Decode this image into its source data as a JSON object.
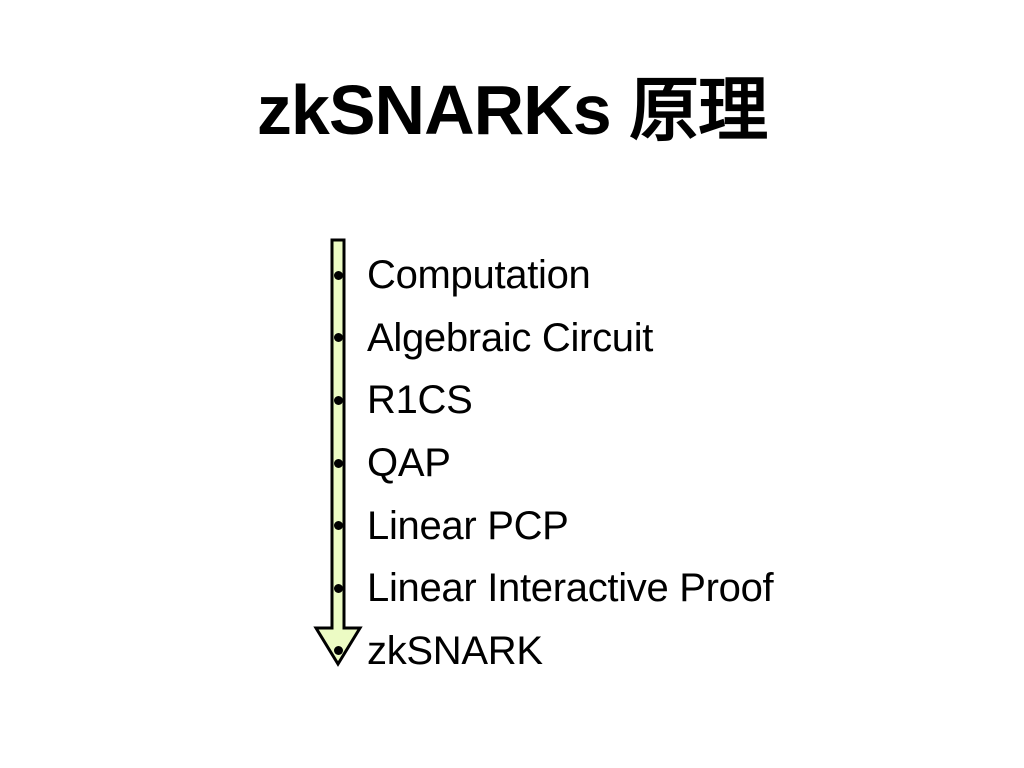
{
  "slide": {
    "title": "zkSNARKs 原理"
  },
  "flow": {
    "arrow_fill": "#ecfbc4",
    "arrow_stroke": "#000000",
    "direction": "down",
    "steps": [
      {
        "label": "Computation"
      },
      {
        "label": "Algebraic Circuit"
      },
      {
        "label": "R1CS"
      },
      {
        "label": "QAP"
      },
      {
        "label": "Linear PCP"
      },
      {
        "label": "Linear Interactive Proof"
      },
      {
        "label": "zkSNARK"
      }
    ]
  }
}
